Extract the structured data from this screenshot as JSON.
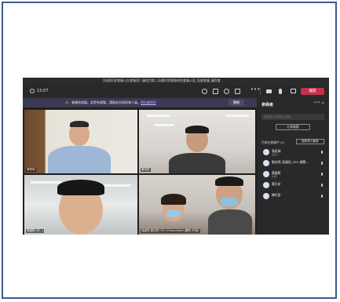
{
  "window": {
    "title": "【局處科室會議公告會議室】議程討論 | 局處科室網路視訊會議公室_局處會議_議程會"
  },
  "toolbar": {
    "time": "13:07",
    "more": "•••",
    "leave_label": "離開"
  },
  "banner": {
    "icon": "⚠",
    "text": "會議有錄製。若是有錄製，請務必告知與會人員。",
    "link": "隱私權原則",
    "button": "關閉"
  },
  "participants_panel": {
    "title": "參與者",
    "close": "✕",
    "more": "•••",
    "invite_placeholder": "邀請某人或撥打號碼",
    "share_button": "分享邀請",
    "section_label": "目前在會議中 (5)",
    "mute_all_button": "將所有人靜音",
    "people": [
      {
        "name": "張君瑞",
        "role": "召集人"
      },
      {
        "name": "劉志明_局處長_CEO 顧問…",
        "role": ""
      },
      {
        "name": "黃國賓",
        "role": "外部"
      },
      {
        "name": "黃文安",
        "role": ""
      },
      {
        "name": "陳世豪",
        "role": ""
      }
    ]
  },
  "video_tiles": [
    {
      "name": "張君瑞"
    },
    {
      "name": "陳世豪"
    },
    {
      "name": "黃國賓 (外...)"
    },
    {
      "name": "局處長 劉志明 CEO (Chao-Hsien) 顧問 (外部)"
    }
  ],
  "colors": {
    "leave": "#c4314b",
    "background": "#1f1f1f",
    "border": "#3d5a8a"
  }
}
